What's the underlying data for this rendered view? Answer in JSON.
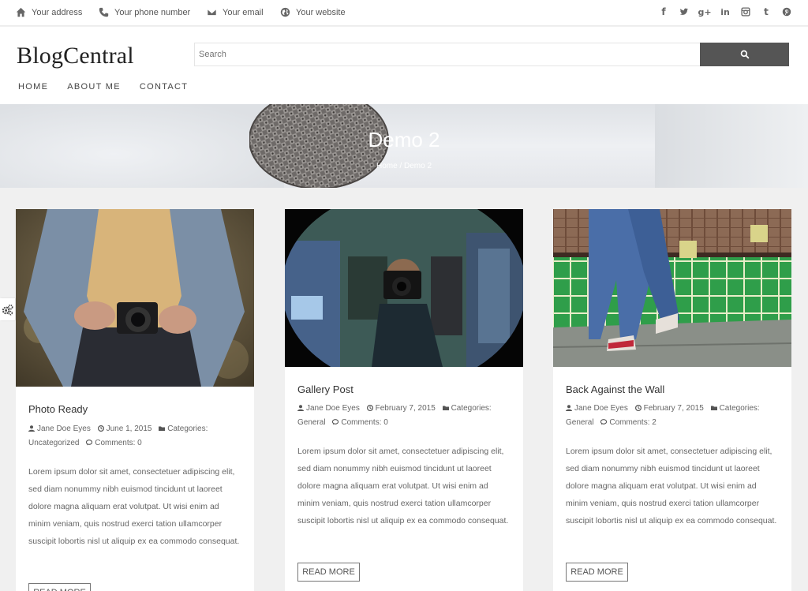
{
  "topbar": {
    "address": "Your address",
    "phone": "Your phone number",
    "email": "Your email",
    "website": "Your website",
    "social_icons": [
      "facebook-icon",
      "twitter-icon",
      "google-plus-icon",
      "linkedin-icon",
      "instagram-icon",
      "tumblr-icon",
      "pinterest-icon"
    ]
  },
  "header": {
    "logo": "BlogCentral",
    "search_placeholder": "Search",
    "nav": [
      "HOME",
      "ABOUT ME",
      "CONTACT"
    ]
  },
  "banner": {
    "title": "Demo 2",
    "breadcrumb": "Home / Demo 2"
  },
  "colors": {
    "accent_button": "#555555",
    "banner_text": "#ffffff"
  },
  "posts": [
    {
      "title": "Photo Ready",
      "author": "Jane Doe Eyes",
      "date": "June 1, 2015",
      "categories_label": "Categories:",
      "category": "Uncategorized",
      "comments_label": "Comments:",
      "comments": "0",
      "excerpt": "Lorem ipsum dolor sit amet, consectetuer adipiscing elit, sed diam nonummy nibh euismod tincidunt ut laoreet dolore magna aliquam erat volutpat. Ut wisi enim ad minim veniam, quis nostrud exerci tation ullamcorper suscipit lobortis nisl ut aliquip ex ea commodo consequat.",
      "button": "READ MORE"
    },
    {
      "title": "Gallery Post",
      "author": "Jane Doe Eyes",
      "date": "February 7, 2015",
      "categories_label": "Categories:",
      "category": "General",
      "comments_label": "Comments:",
      "comments": "0",
      "excerpt": "Lorem ipsum dolor sit amet, consectetuer adipiscing elit, sed diam nonummy nibh euismod tincidunt ut laoreet dolore magna aliquam erat volutpat. Ut wisi enim ad minim veniam, quis nostrud exerci tation ullamcorper suscipit lobortis nisl ut aliquip ex ea commodo consequat.",
      "button": "READ MORE"
    },
    {
      "title": "Back Against the Wall",
      "author": "Jane Doe Eyes",
      "date": "February 7, 2015",
      "categories_label": "Categories:",
      "category": "General",
      "comments_label": "Comments:",
      "comments": "2",
      "excerpt": "Lorem ipsum dolor sit amet, consectetuer adipiscing elit, sed diam nonummy nibh euismod tincidunt ut laoreet dolore magna aliquam erat volutpat. Ut wisi enim ad minim veniam, quis nostrud exerci tation ullamcorper suscipit lobortis nisl ut aliquip ex ea commodo consequat.",
      "button": "READ MORE"
    }
  ]
}
